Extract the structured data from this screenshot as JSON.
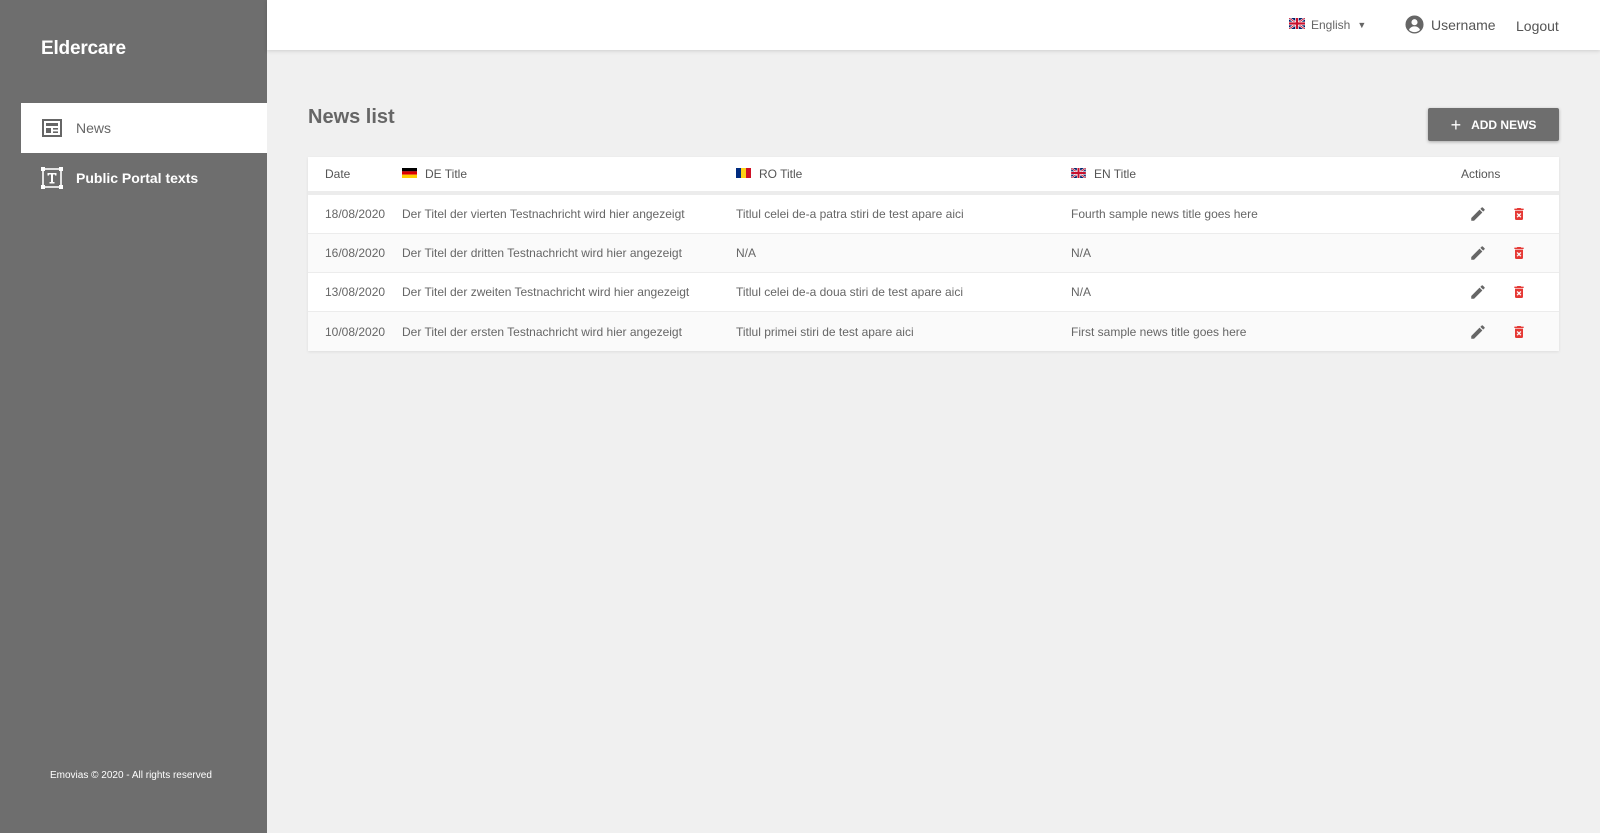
{
  "app": {
    "brand": "Eldercare",
    "footer": "Emovias © 2020 - All rights reserved"
  },
  "sidebar": {
    "items": [
      {
        "label": "News",
        "icon": "newspaper-icon",
        "active": true
      },
      {
        "label": "Public Portal texts",
        "icon": "text-format-icon",
        "active": false
      }
    ]
  },
  "topbar": {
    "language": "English",
    "username": "Username",
    "logout": "Logout"
  },
  "main": {
    "title": "News list",
    "add_button": "ADD NEWS",
    "columns": {
      "date": "Date",
      "de": "DE Title",
      "ro": "RO Title",
      "en": "EN Title",
      "actions": "Actions"
    },
    "rows": [
      {
        "date": "18/08/2020",
        "de": "Der Titel der vierten Testnachricht wird hier angezeigt",
        "ro": "Titlul celei de-a patra stiri de test apare aici",
        "en": "Fourth sample news title goes here"
      },
      {
        "date": "16/08/2020",
        "de": "Der Titel der dritten Testnachricht wird hier angezeigt",
        "ro": "N/A",
        "en": "N/A"
      },
      {
        "date": "13/08/2020",
        "de": "Der Titel der zweiten Testnachricht wird hier angezeigt",
        "ro": "Titlul celei de-a doua stiri de test apare aici",
        "en": "N/A"
      },
      {
        "date": "10/08/2020",
        "de": "Der Titel der ersten Testnachricht wird hier angezeigt",
        "ro": "Titlul primei stiri de test apare aici",
        "en": "First sample news title goes here"
      }
    ]
  },
  "colors": {
    "sidebar": "#6e6e6e",
    "accent": "#6e6e6e",
    "delete": "#e53935"
  }
}
